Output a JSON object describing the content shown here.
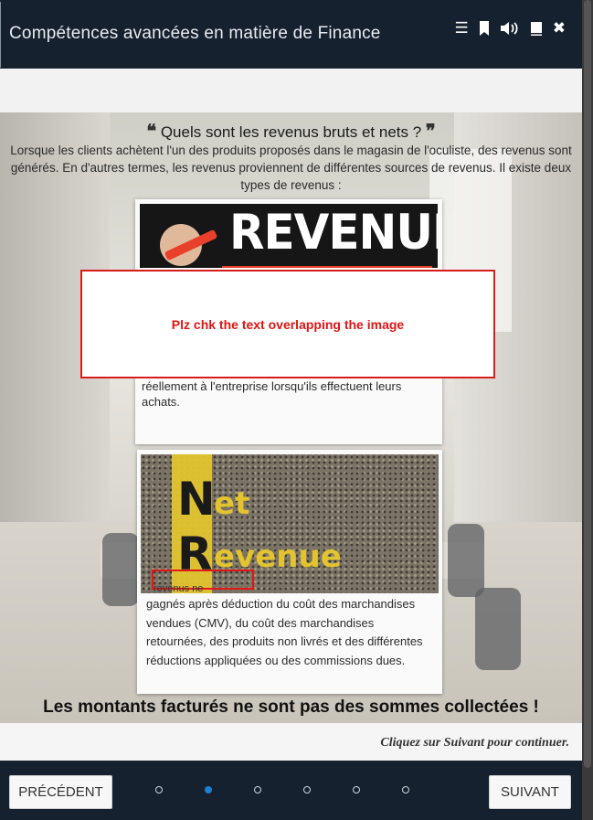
{
  "header": {
    "title": "Compétences avancées en matière de Finance",
    "toolbar": [
      {
        "icon": "list-icon",
        "glyph": "☰"
      },
      {
        "icon": "bookmark-icon",
        "glyph": "❚"
      },
      {
        "icon": "audio-icon",
        "glyph": "🔊"
      },
      {
        "icon": "book-icon",
        "glyph": "▮"
      },
      {
        "icon": "close-icon",
        "glyph": "✖"
      }
    ]
  },
  "content": {
    "open_quote": "❝",
    "heading": "Quels sont les revenus bruts et nets ?",
    "close_quote": "❞",
    "intro": "Lorsque les clients achètent l'un des produits proposés dans le magasin de l'oculiste, des revenus sont générés. En d'autres termes, les revenus proviennent de différentes sources de revenus. Il existe deux types de revenus :",
    "card1": {
      "image_word": "REVENUE",
      "text": "réellement à l'entreprise lorsqu'ils effectuent leurs achats."
    },
    "card2": {
      "image_letter_n": "N",
      "image_word_et": "et",
      "image_letter_r": "R",
      "image_word_evenue": "evenue",
      "overlap_text": "revenus ne",
      "text": "gagnés après déduction du coût des marchandises vendues (CMV), du coût des marchandises retournées, des produits non livrés et des différentes réductions appliquées ou des commissions dues."
    },
    "annotation": "Plz chk the text overlapping the image",
    "bottom_note": "Les montants facturés ne sont pas des sommes collectées !"
  },
  "continue_hint": "Cliquez sur Suivant pour continuer.",
  "footer": {
    "prev_label": "PRÉCÉDENT",
    "next_label": "SUIVANT",
    "page_count": 6,
    "active_page": 2
  },
  "colors": {
    "header_bg": "#15212e",
    "active_dot": "#1e7fd0",
    "annotation_red": "#e01414",
    "revenue_accent": "#e8402a",
    "net_yellow": "#e3c42f"
  }
}
